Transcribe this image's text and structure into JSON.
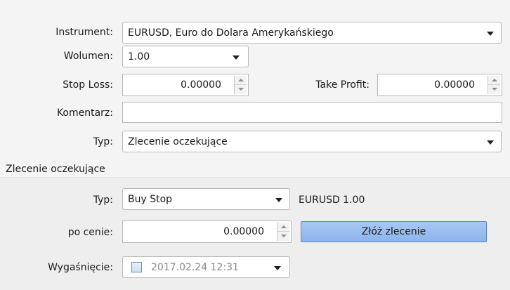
{
  "form": {
    "instrument_label": "Instrument:",
    "instrument_value": "EURUSD, Euro do Dolara Amerykańskiego",
    "volume_label": "Wolumen:",
    "volume_value": "1.00",
    "stop_loss_label": "Stop Loss:",
    "stop_loss_value": "0.00000",
    "take_profit_label": "Take Profit:",
    "take_profit_value": "0.00000",
    "comment_label": "Komentarz:",
    "comment_value": "",
    "type_label": "Typ:",
    "type_value": "Zlecenie oczekujące"
  },
  "pending": {
    "section_title": "Zlecenie oczekujące",
    "type_label": "Typ:",
    "type_value": "Buy Stop",
    "summary": "EURUSD 1.00",
    "price_label": "po cenie:",
    "price_value": "0.00000",
    "submit_label": "Złóż zlecenie",
    "expiry_label": "Wygaśnięcie:",
    "expiry_value": "2017.02.24 12:31",
    "expiry_checked": false
  },
  "icons": {
    "dropdown": "chevron-down-icon",
    "spin": "spin-up-down-icon",
    "checkbox": "checkbox-icon"
  },
  "colors": {
    "submit_button": "#9dbef0",
    "panel_background": "#eeeeee",
    "field_border": "#b8b8b8"
  }
}
